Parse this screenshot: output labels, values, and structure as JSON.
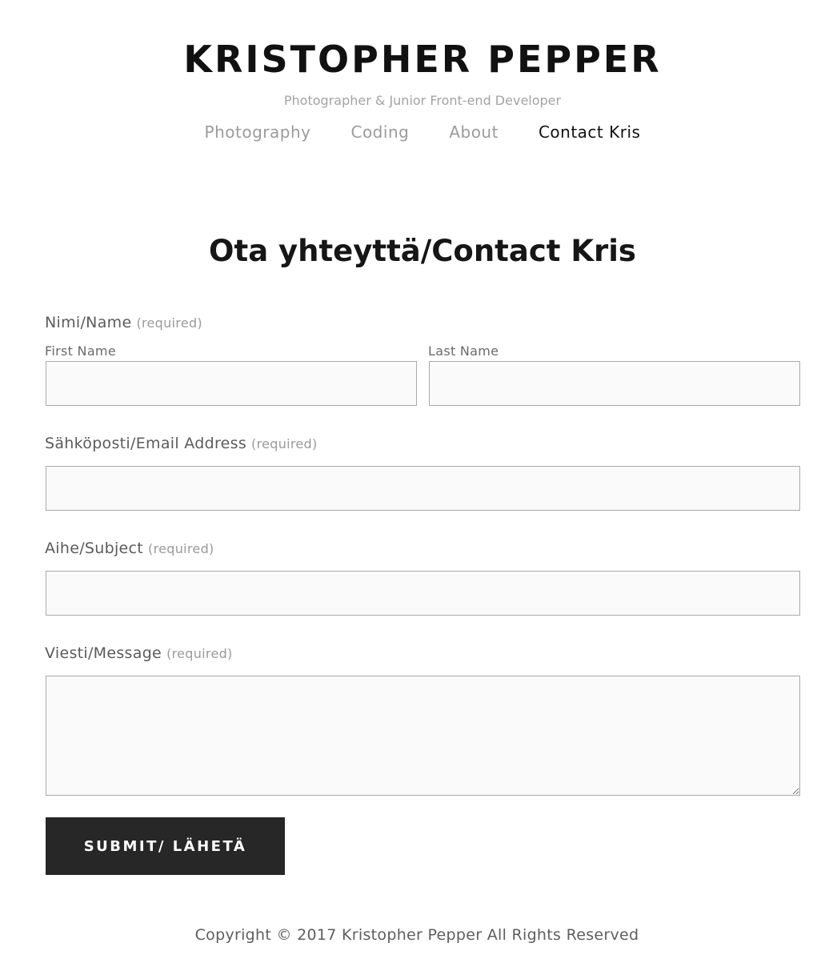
{
  "header": {
    "site_title": "KRISTOPHER PEPPER",
    "tagline": "Photographer & Junior Front-end Developer",
    "nav": [
      {
        "label": "Photography",
        "active": false
      },
      {
        "label": "Coding",
        "active": false
      },
      {
        "label": "About",
        "active": false
      },
      {
        "label": "Contact Kris",
        "active": true
      }
    ]
  },
  "main": {
    "heading": "Ota yhteyttä/Contact Kris",
    "form": {
      "required_text": "(required)",
      "name": {
        "label": "Nimi/Name",
        "first_label": "First Name",
        "last_label": "Last Name",
        "first_value": "",
        "last_value": ""
      },
      "email": {
        "label": "Sähköposti/Email Address",
        "value": ""
      },
      "subject": {
        "label": "Aihe/Subject",
        "value": ""
      },
      "message": {
        "label": "Viesti/Message",
        "value": ""
      },
      "submit_label": "SUBMIT/ LÄHETÄ"
    }
  },
  "footer": {
    "copyright": "Copyright © 2017 Kristopher Pepper All Rights Reserved"
  },
  "colors": {
    "text": "#111111",
    "muted": "#9b9b9b",
    "field_bg": "#fafafa",
    "field_border": "#a9a9a9",
    "button_bg": "#272727",
    "button_text": "#ffffff"
  }
}
